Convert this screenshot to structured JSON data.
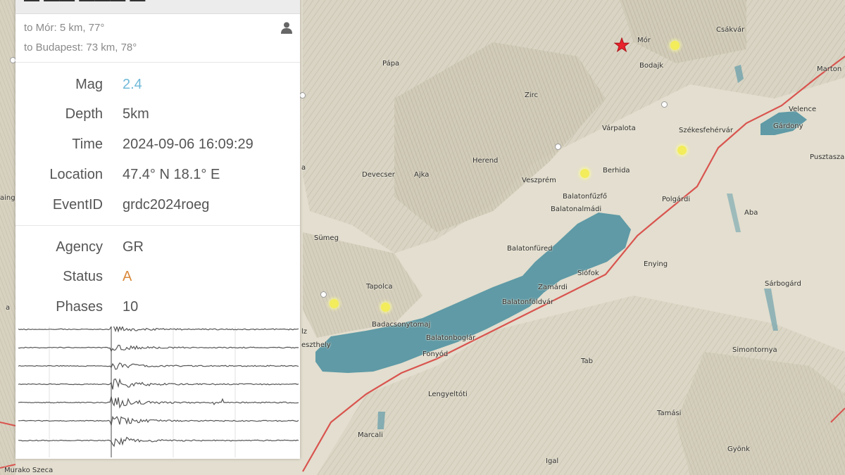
{
  "panel": {
    "distances": {
      "line1": "to Mór: 5 km, 77°",
      "line2": "to Budapest: 73 km, 78°"
    },
    "fields": {
      "mag": {
        "label": "Mag",
        "value": "2.4"
      },
      "depth": {
        "label": "Depth",
        "value": "5km"
      },
      "time": {
        "label": "Time",
        "value": "2024-09-06 16:09:29"
      },
      "location": {
        "label": "Location",
        "value": "47.4° N 18.1° E"
      },
      "event_id": {
        "label": "EventID",
        "value": "grdc2024roeg"
      },
      "agency": {
        "label": "Agency",
        "value": "GR"
      },
      "status": {
        "label": "Status",
        "value": "A"
      },
      "phases": {
        "label": "Phases",
        "value": "10"
      }
    },
    "icons": {
      "user": "user-icon"
    },
    "colors": {
      "mag_value": "#6fb9d8",
      "status_value": "#d9893a"
    }
  },
  "map": {
    "places": {
      "mor": "Mór",
      "csakvar": "Csákvár",
      "martonvasar": "Marton",
      "papa": "Pápa",
      "bodajk": "Bodajk",
      "zirc": "Zirc",
      "varpalota": "Várpalota",
      "velence": "Velence",
      "gardony": "Gárdony",
      "szekesfehervar": "Székesfehérvár",
      "pusztaszabolcs": "Pusztaszab",
      "herend": "Herend",
      "devecser": "Devecser",
      "ajka": "Ajka",
      "veszprem": "Veszprém",
      "berhida": "Berhida",
      "balatonfuzfo": "Balatonfűzfő",
      "balatonalmadi": "Balatonalmádi",
      "polgardi": "Polgárdi",
      "aba": "Aba",
      "sumeg": "Sümeg",
      "balatonfured": "Balatonfüred",
      "siofok": "Siófok",
      "enying": "Enying",
      "tapolca": "Tapolca",
      "zamardi": "Zamárdi",
      "balatonfoldvar": "Balatonföldvár",
      "sarbogard": "Sárbogárd",
      "badacsonytomaj": "Badacsonytomaj",
      "balatonboglar": "Balatonboglár",
      "keszthely": "eszthely",
      "fonyod": "Fonyód",
      "simontornya": "Simontornya",
      "tab": "Tab",
      "lengyeltoti": "Lengyeltóti",
      "tamasi": "Tamási",
      "marcali": "Marcali",
      "gyonk": "Gyönk",
      "igal": "Igal",
      "murakeresztur": "Murako Szeca",
      "left_a": "aing",
      "left_b": "a",
      "left_c": "a",
      "left_d": "lz"
    },
    "epicenter_icon": "red-star-icon",
    "colors": {
      "lake": "#5f9aa6",
      "road": "#d9544f",
      "epicenter": "#e8232b"
    }
  }
}
